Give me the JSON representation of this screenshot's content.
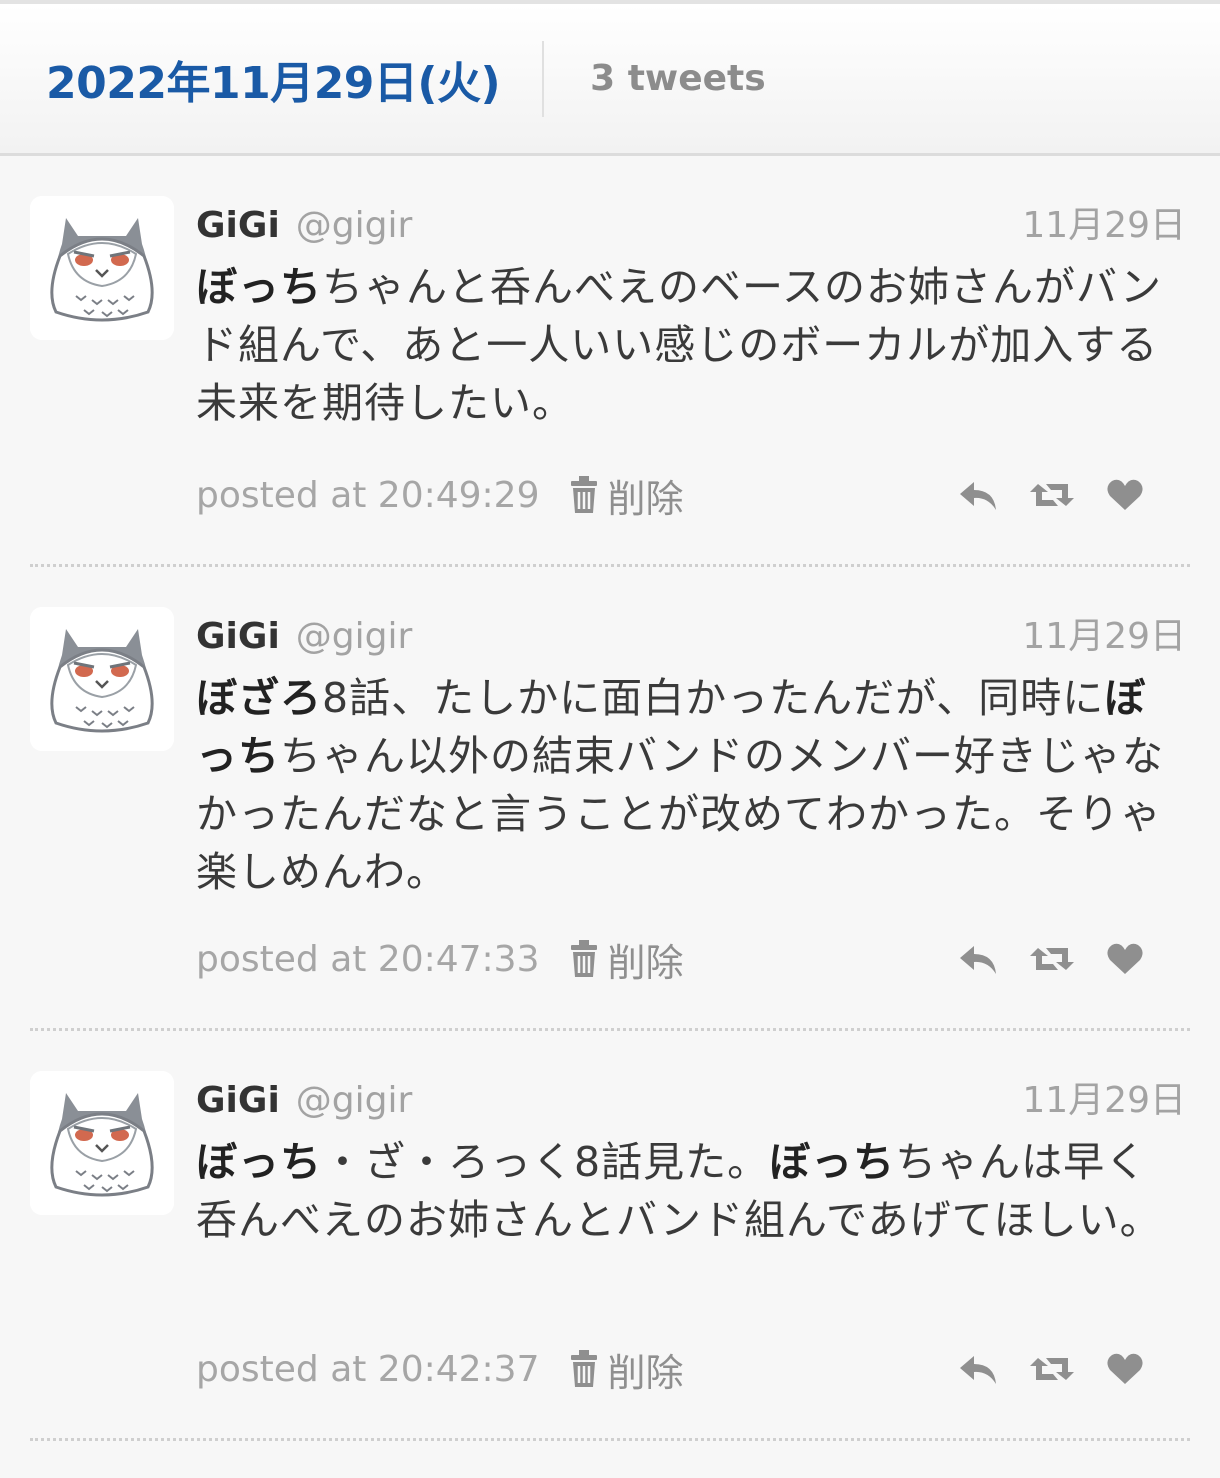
{
  "header": {
    "date": "2022年11月29日(火)",
    "count": "3 tweets"
  },
  "delete_label": "削除",
  "tweets": [
    {
      "user_name": "GiGi",
      "screen_name": "@gigir",
      "date": "11月29日",
      "segments": [
        {
          "text": "ぼっち",
          "bold": true
        },
        {
          "text": "ちゃんと呑んべえのベースのお姉さんがバンド組んで、あと一人いい感じのボーカルが加入する未来を期待したい。",
          "bold": false
        }
      ],
      "posted_at": "posted at 20:49:29"
    },
    {
      "user_name": "GiGi",
      "screen_name": "@gigir",
      "date": "11月29日",
      "segments": [
        {
          "text": "ぼざろ",
          "bold": true
        },
        {
          "text": "8話、たしかに面白かったんだが、同時に",
          "bold": false
        },
        {
          "text": "ぼっち",
          "bold": true
        },
        {
          "text": "ちゃん以外の結束バンドのメンバー好きじゃなかったんだなと言うことが改めてわかった。そりゃ楽しめんわ。",
          "bold": false
        }
      ],
      "posted_at": "posted at 20:47:33"
    },
    {
      "user_name": "GiGi",
      "screen_name": "@gigir",
      "date": "11月29日",
      "segments": [
        {
          "text": "ぼっち",
          "bold": true
        },
        {
          "text": "・ざ・ろっく8話見た。",
          "bold": false
        },
        {
          "text": "ぼっち",
          "bold": true
        },
        {
          "text": "ちゃんは早く呑んべえのお姉さんとバンド組んであげてほしい。",
          "bold": false
        }
      ],
      "posted_at": "posted at 20:42:37"
    }
  ],
  "icons": {
    "avatar": "owl-avatar",
    "delete": "trash-icon",
    "reply": "reply-icon",
    "retweet": "retweet-icon",
    "like": "heart-icon"
  },
  "colors": {
    "link": "#1a5aa6",
    "muted": "#a3a3a3",
    "icon": "#8f8f8f"
  }
}
